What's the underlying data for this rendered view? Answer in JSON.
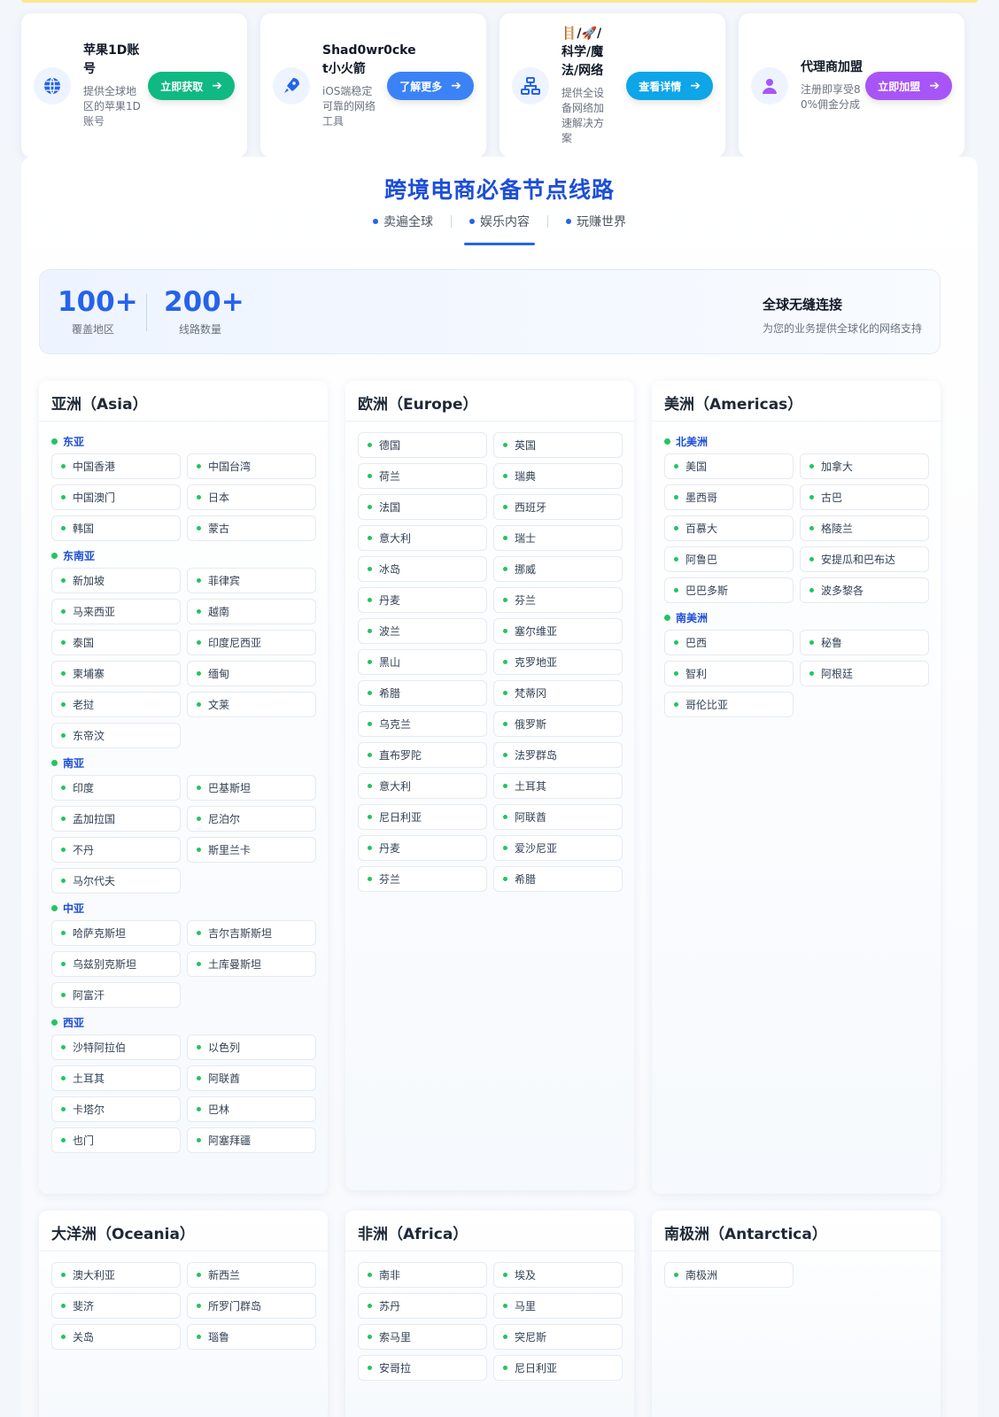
{
  "promos": [
    {
      "title": "苹果1D账号",
      "desc": "提供全球地区的苹果1D账号",
      "button": "立即获取",
      "icon": "globe-icon",
      "color": "#10b981"
    },
    {
      "title": "Shad0wr0cket小火箭",
      "desc": "iOS端稳定可靠的网络工具",
      "button": "了解更多",
      "icon": "rocket-icon",
      "color": "#3b82f6"
    },
    {
      "title": "🪜/🚀/科学/魔法/网络",
      "desc": "提供全设备网络加速解决方案",
      "button": "查看详情",
      "icon": "network-icon",
      "color": "#0ea5e9"
    },
    {
      "title": "代理商加盟",
      "desc": "注册即享受80%佣金分成",
      "button": "立即加盟",
      "icon": "agent-icon",
      "color": "#a855f7"
    }
  ],
  "main": {
    "title": "跨境电商必备节点线路",
    "tabs": [
      "卖遍全球",
      "娱乐内容",
      "玩赚世界"
    ],
    "active_tab": 1,
    "stats": [
      {
        "num": "100+",
        "label": "覆盖地区"
      },
      {
        "num": "200+",
        "label": "线路数量"
      }
    ],
    "global_title": "全球无缝连接",
    "global_desc": "为您的业务提供全球化的网络支持"
  },
  "regions": [
    {
      "title": "亚洲（Asia）",
      "groups": [
        {
          "name": "东亚",
          "items": [
            "中国香港",
            "中国台湾",
            "中国澳门",
            "日本",
            "韩国",
            "蒙古"
          ]
        },
        {
          "name": "东南亚",
          "items": [
            "新加坡",
            "菲律宾",
            "马来西亚",
            "越南",
            "泰国",
            "印度尼西亚",
            "柬埔寨",
            "缅甸",
            "老挝",
            "文莱",
            "东帝汶"
          ]
        },
        {
          "name": "南亚",
          "items": [
            "印度",
            "巴基斯坦",
            "孟加拉国",
            "尼泊尔",
            "不丹",
            "斯里兰卡",
            "马尔代夫"
          ]
        },
        {
          "name": "中亚",
          "items": [
            "哈萨克斯坦",
            "吉尔吉斯斯坦",
            "乌兹别克斯坦",
            "土库曼斯坦",
            "阿富汗"
          ]
        },
        {
          "name": "西亚",
          "items": [
            "沙特阿拉伯",
            "以色列",
            "土耳其",
            "阿联酋",
            "卡塔尔",
            "巴林",
            "也门",
            "阿塞拜疆"
          ]
        }
      ]
    },
    {
      "title": "欧洲（Europe）",
      "groups": [
        {
          "name": "",
          "items": [
            "德国",
            "英国",
            "荷兰",
            "瑞典",
            "法国",
            "西班牙",
            "意大利",
            "瑞士",
            "冰岛",
            "挪威",
            "丹麦",
            "芬兰",
            "波兰",
            "塞尔维亚",
            "黑山",
            "克罗地亚",
            "希腊",
            "梵蒂冈",
            "乌克兰",
            "俄罗斯",
            "直布罗陀",
            "法罗群岛",
            "意大利",
            "土耳其",
            "尼日利亚",
            "阿联酋",
            "丹麦",
            "爱沙尼亚",
            "芬兰",
            "希腊"
          ]
        }
      ]
    },
    {
      "title": "美洲（Americas）",
      "groups": [
        {
          "name": "北美洲",
          "items": [
            "美国",
            "加拿大",
            "墨西哥",
            "古巴",
            "百慕大",
            "格陵兰",
            "阿鲁巴",
            "安提瓜和巴布达",
            "巴巴多斯",
            "波多黎各"
          ]
        },
        {
          "name": "南美洲",
          "items": [
            "巴西",
            "秘鲁",
            "智利",
            "阿根廷",
            "哥伦比亚"
          ]
        }
      ]
    },
    {
      "title": "大洋洲（Oceania）",
      "groups": [
        {
          "name": "",
          "items": [
            "澳大利亚",
            "新西兰",
            "斐济",
            "所罗门群岛",
            "关岛",
            "瑙鲁"
          ]
        }
      ]
    },
    {
      "title": "非洲（Africa）",
      "groups": [
        {
          "name": "",
          "items": [
            "南非",
            "埃及",
            "苏丹",
            "马里",
            "索马里",
            "突尼斯",
            "安哥拉",
            "尼日利亚"
          ]
        }
      ]
    },
    {
      "title": "南极洲（Antarctica）",
      "groups": [
        {
          "name": "",
          "items": [
            "南极洲"
          ]
        }
      ]
    }
  ]
}
